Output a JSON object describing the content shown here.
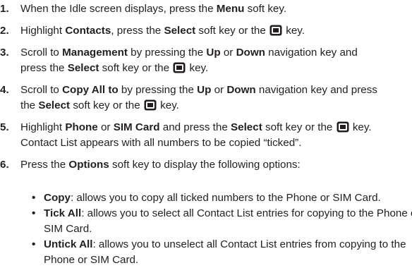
{
  "steps": [
    {
      "num": "1.",
      "a": "When the Idle screen displays, press the ",
      "b1": "Menu",
      "c": " soft key."
    },
    {
      "num": "2.",
      "a": "Highlight ",
      "b1": "Contacts",
      "c": ", press the ",
      "b2": "Select",
      "d": " soft key or the ",
      "e": " key."
    },
    {
      "num": "3.",
      "a": "Scroll to ",
      "b1": "Management",
      "c": " by pressing the ",
      "b2": "Up",
      "d": " or ",
      "b3": "Down",
      "e": " navigation key and",
      "l2a": "press the ",
      "l2b": "Select",
      "l2c": " soft key or the ",
      "l2d": " key."
    },
    {
      "num": "4.",
      "a": "Scroll to ",
      "b1": "Copy All to",
      "c": " by pressing the ",
      "b2": "Up",
      "d": " or ",
      "b3": "Down",
      "e": " navigation key and press",
      "l2a": "the ",
      "l2b": "Select",
      "l2c": " soft key or the ",
      "l2d": " key."
    },
    {
      "num": "5.",
      "a": "Highlight ",
      "b1": "Phone",
      "c": " or ",
      "b2": "SIM Card",
      "d": " and press the ",
      "b3": "Select",
      "e": " soft key or the ",
      "f": " key.",
      "l2": "Contact List appears with all numbers to be copied “ticked”."
    },
    {
      "num": "6.",
      "a": "Press the ",
      "b1": "Options",
      "c": " soft key to display the following options:"
    }
  ],
  "options": [
    {
      "bullet": "•",
      "term": "Copy",
      "l1": ": allows you to copy all ticked numbers to the Phone or SIM Card."
    },
    {
      "bullet": "•",
      "term": "Tick All",
      "l1": ": allows you to select all Contact List entries for copying to the Phone or",
      "l2": "SIM Card."
    },
    {
      "bullet": "•",
      "term": "Untick All",
      "l1": ": allows you to unselect all Contact List entries from copying to the",
      "l2": "Phone or SIM Card."
    }
  ],
  "icons": {
    "select_key": "select-key-icon"
  }
}
